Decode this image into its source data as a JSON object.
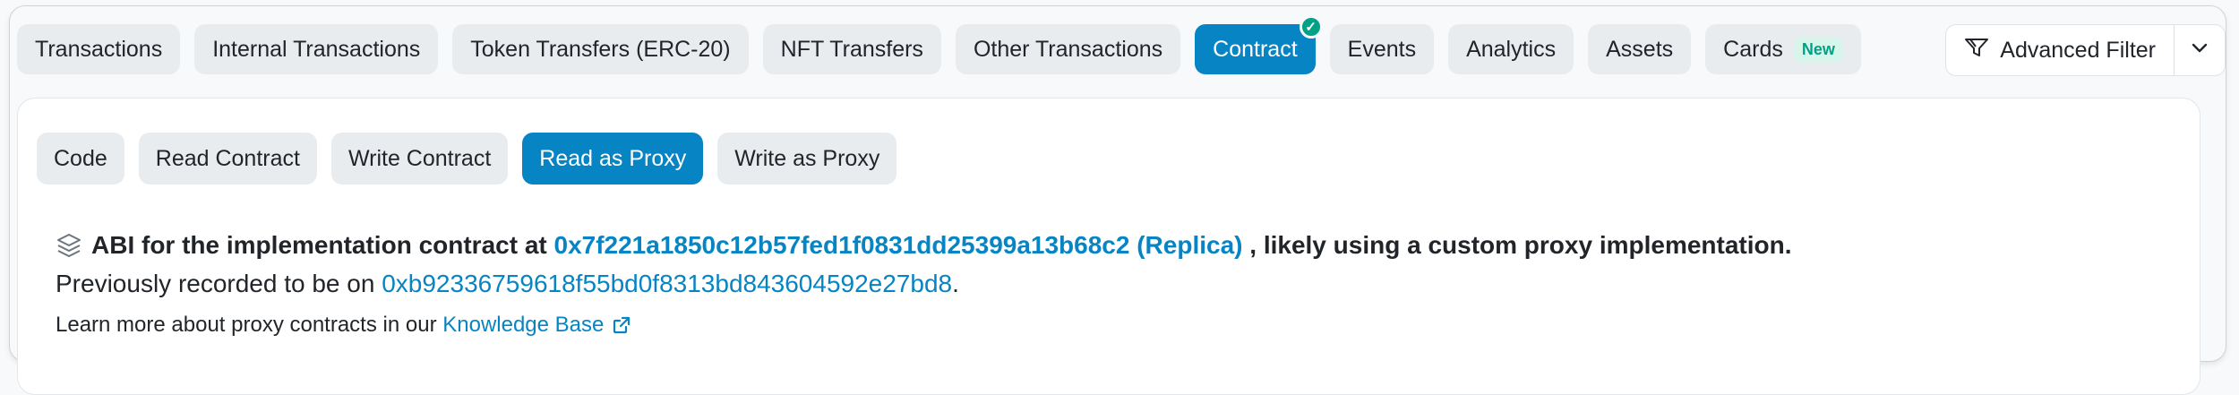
{
  "tabs": [
    {
      "label": "Transactions"
    },
    {
      "label": "Internal Transactions"
    },
    {
      "label": "Token Transfers (ERC-20)"
    },
    {
      "label": "NFT Transfers"
    },
    {
      "label": "Other Transactions"
    },
    {
      "label": "Contract",
      "active": true,
      "verified": true
    },
    {
      "label": "Events"
    },
    {
      "label": "Analytics"
    },
    {
      "label": "Assets"
    },
    {
      "label": "Cards",
      "badge": "New"
    }
  ],
  "filter": {
    "label": "Advanced Filter",
    "icon": "filter-icon"
  },
  "subtabs": [
    {
      "label": "Code"
    },
    {
      "label": "Read Contract"
    },
    {
      "label": "Write Contract"
    },
    {
      "label": "Read as Proxy",
      "active": true
    },
    {
      "label": "Write as Proxy"
    }
  ],
  "info": {
    "abi_prefix": "ABI for the implementation contract at",
    "impl_address": "0x7f221a1850c12b57fed1f0831dd25399a13b68c2",
    "replica": "(Replica)",
    "abi_suffix": ", likely using a custom proxy implementation.",
    "prev_prefix": "Previously recorded to be on",
    "prev_address": "0xb92336759618f55bd0f8313bd843604592e27bd8",
    "prev_suffix": ".",
    "learn_prefix": "Learn more about proxy contracts in our",
    "kb_link": "Knowledge Base"
  },
  "colors": {
    "accent": "#0784c3",
    "success": "#00a186",
    "tab_bg": "#e9ecef"
  }
}
